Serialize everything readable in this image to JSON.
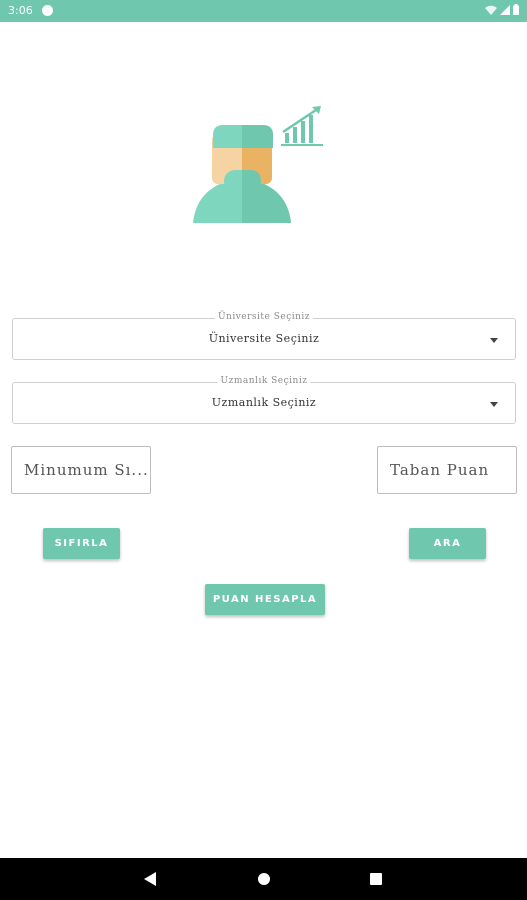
{
  "status_bar": {
    "time": "3:06",
    "icons": [
      "app-notification-icon",
      "wifi-icon",
      "signal-icon",
      "battery-icon"
    ]
  },
  "hero": {
    "icon": "doctor-with-chart-icon",
    "colors": {
      "primary": "#6fc7ad",
      "skin_light": "#f5d3a3",
      "skin_dark": "#e9b363"
    }
  },
  "university_select": {
    "legend": "Üniversite Seçiniz",
    "value": "Üniversite Seçiniz"
  },
  "specialty_select": {
    "legend": "Uzmanlık Seçiniz",
    "value": "Uzmanlık Seçiniz"
  },
  "fields": {
    "min_score_placeholder": "Minumum Sı...",
    "base_score_placeholder": "Taban Puan"
  },
  "buttons": {
    "reset": "SIFIRLA",
    "search": "ARA",
    "calculate": "PUAN HESAPLA"
  },
  "theme": {
    "accent": "#6fc7ad"
  },
  "nav_bar": {
    "icons": [
      "back-icon",
      "home-icon",
      "recents-icon"
    ]
  }
}
